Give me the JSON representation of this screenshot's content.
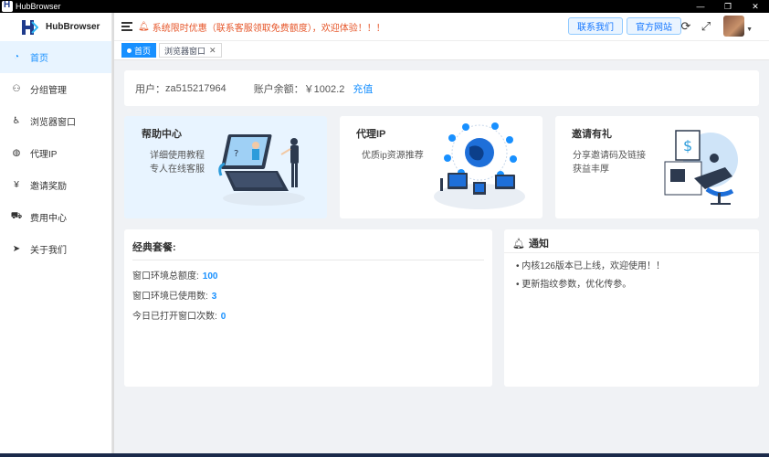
{
  "window": {
    "title": "HubBrowser",
    "controls": [
      "—",
      "❐",
      "✕"
    ]
  },
  "sidebar": {
    "logo_text": "HubBrowser",
    "items": [
      {
        "label": "首页",
        "icon": "dashboard-icon",
        "glyph": "◔",
        "active": true
      },
      {
        "label": "分组管理",
        "icon": "group-icon",
        "glyph": "⚇",
        "active": false
      },
      {
        "label": "浏览器窗口",
        "icon": "browser-window-icon",
        "glyph": "♿",
        "active": false
      },
      {
        "label": "代理IP",
        "icon": "globe-icon",
        "glyph": "◍",
        "active": false
      },
      {
        "label": "邀请奖励",
        "icon": "yen-icon",
        "glyph": "¥",
        "active": false
      },
      {
        "label": "费用中心",
        "icon": "cart-icon",
        "glyph": "⛟",
        "active": false
      },
      {
        "label": "关于我们",
        "icon": "send-icon",
        "glyph": "➤",
        "active": false
      }
    ]
  },
  "header": {
    "notice": "系统限时优惠（联系客服领取免费额度），欢迎体验！！！",
    "contact_label": "联系我们",
    "website_label": "官方网站"
  },
  "tabs": [
    {
      "label": "首页",
      "active": true
    },
    {
      "label": "浏览器窗口",
      "active": false
    }
  ],
  "account": {
    "user_label": "用户：",
    "username": "za515217964",
    "balance_label": "账户余额：",
    "balance": "￥1002.2",
    "recharge_label": "充值"
  },
  "features": [
    {
      "title": "帮助中心",
      "lines": [
        "详细使用教程",
        "专人在线客服"
      ]
    },
    {
      "title": "代理IP",
      "lines": [
        "优质ip资源推荐"
      ]
    },
    {
      "title": "邀请有礼",
      "lines": [
        "分享邀请码及链接",
        "获益丰厚"
      ]
    }
  ],
  "package": {
    "title": "经典套餐:",
    "rows": [
      {
        "label": "窗口环境总额度:",
        "value": "100"
      },
      {
        "label": "窗口环境已使用数:",
        "value": "3"
      },
      {
        "label": "今日已打开窗口次数:",
        "value": "0"
      }
    ]
  },
  "notifications": {
    "title": "通知",
    "items": [
      "内核126版本已上线，欢迎使用！！",
      "更新指纹参数，优化传参。"
    ]
  },
  "colors": {
    "accent": "#1890ff",
    "notice": "#e6562a",
    "active_bg": "#e8f4ff"
  }
}
